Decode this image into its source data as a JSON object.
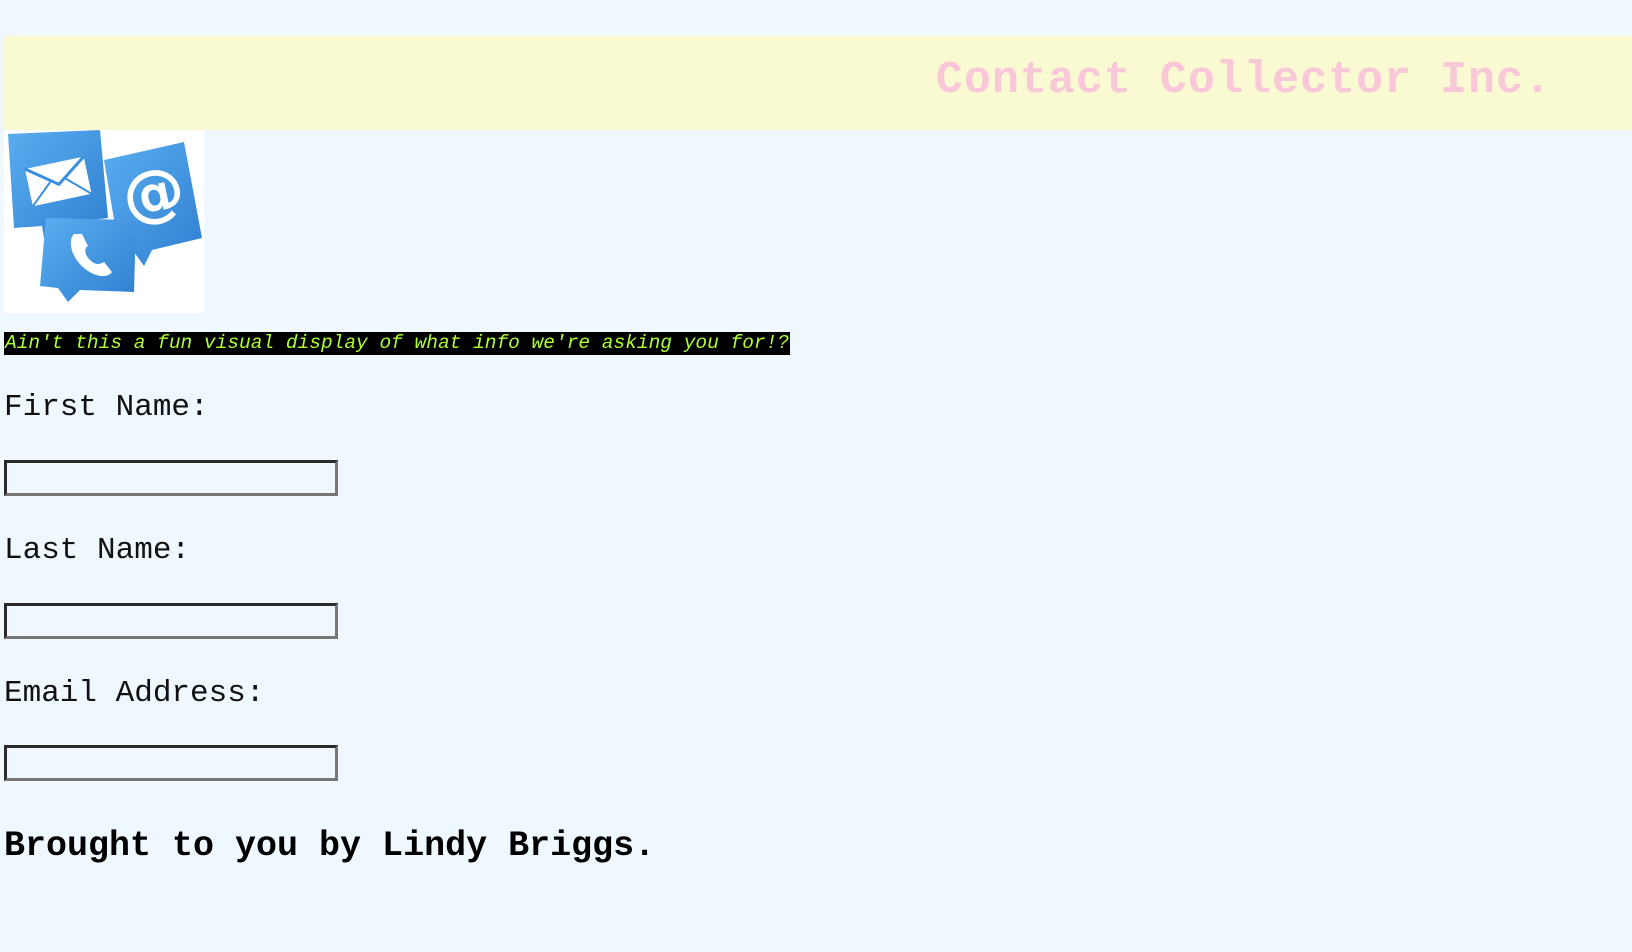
{
  "header": {
    "title": "Contact Collector Inc.",
    "background_color": "#fafad2",
    "title_color": "#f8c8d8"
  },
  "logo": {
    "icons": [
      "mail-icon",
      "at-sign-icon",
      "phone-icon"
    ],
    "icon_color": "#3a8fdc"
  },
  "caption": {
    "text": "Ain't this a fun visual display of what info we're asking you for!?",
    "background_color": "#000000",
    "text_color": "#adff2f"
  },
  "form": {
    "first_name": {
      "label": "First Name:",
      "value": ""
    },
    "last_name": {
      "label": "Last Name:",
      "value": ""
    },
    "email": {
      "label": "Email Address:",
      "value": ""
    }
  },
  "footer": {
    "text": "Brought to you by Lindy Briggs."
  },
  "page": {
    "background_color": "#f0f8ff"
  }
}
